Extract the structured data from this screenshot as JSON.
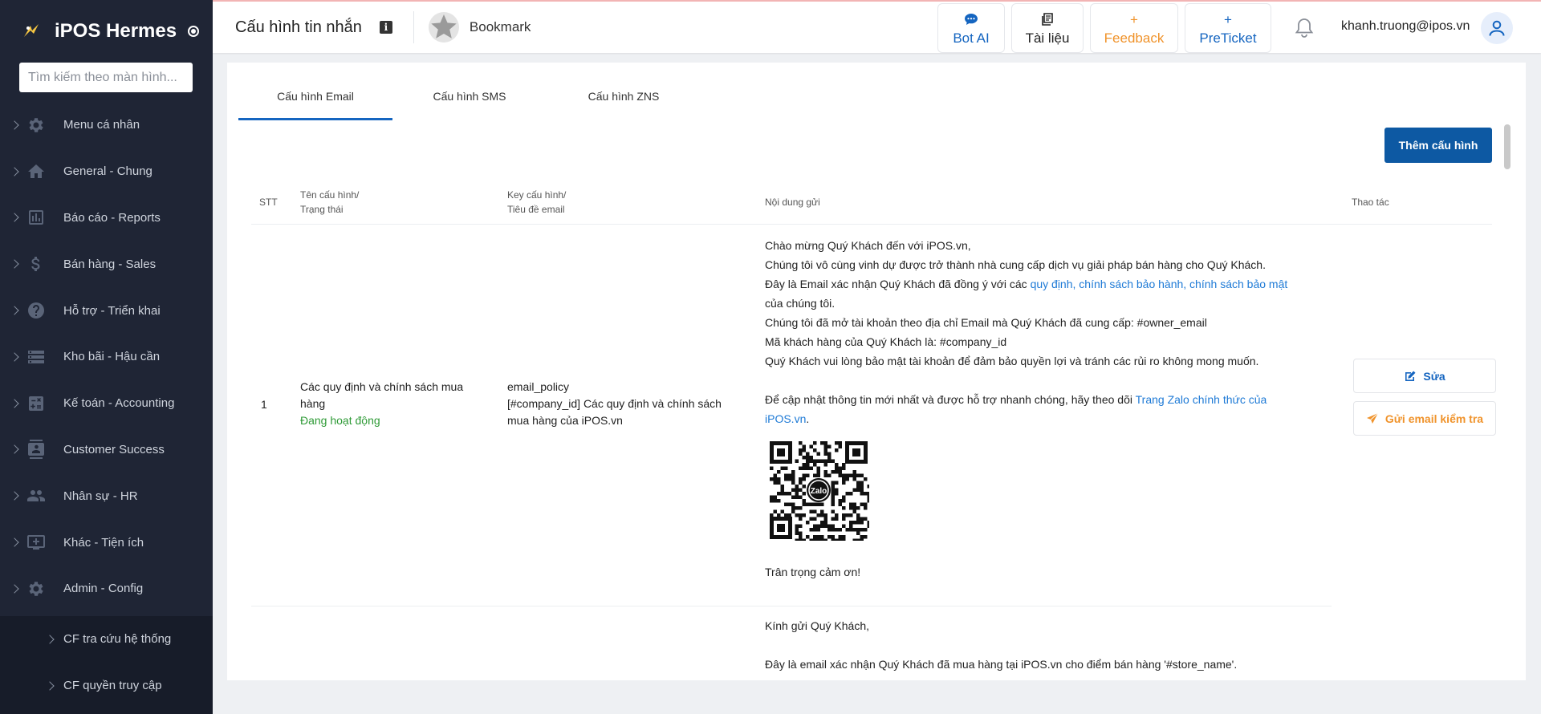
{
  "app": {
    "brand": "iPOS Hermes"
  },
  "sidebar": {
    "search_placeholder": "Tìm kiếm theo màn hình...",
    "items": [
      {
        "label": "Menu cá nhân",
        "icon": "gear-icon"
      },
      {
        "label": "General - Chung",
        "icon": "home-icon"
      },
      {
        "label": "Báo cáo - Reports",
        "icon": "chart-icon"
      },
      {
        "label": "Bán hàng - Sales",
        "icon": "dollar-icon"
      },
      {
        "label": "Hỗ trợ - Triển khai",
        "icon": "help-icon"
      },
      {
        "label": "Kho bãi - Hậu cần",
        "icon": "warehouse-icon"
      },
      {
        "label": "Kế toán - Accounting",
        "icon": "accounting-icon"
      },
      {
        "label": "Customer Success",
        "icon": "customer-icon"
      },
      {
        "label": "Nhân sự - HR",
        "icon": "people-icon"
      },
      {
        "label": "Khác - Tiện ích",
        "icon": "add-screen-icon"
      },
      {
        "label": "Admin - Config",
        "icon": "gear-icon"
      }
    ],
    "subitems": [
      {
        "label": "CF tra cứu hệ thống"
      },
      {
        "label": "CF quyền truy cập"
      }
    ]
  },
  "header": {
    "title": "Cấu hình tin nhắn",
    "info_icon": "i",
    "bookmark_label": "Bookmark",
    "buttons": {
      "bot_ai": "Bot AI",
      "docs": "Tài liệu",
      "feedback": "Feedback",
      "preticket": "PreTicket"
    },
    "plus_glyph": "+",
    "user_email": "khanh.truong@ipos.vn"
  },
  "tabs": [
    {
      "label": "Cấu hình Email",
      "active": true
    },
    {
      "label": "Cấu hình SMS",
      "active": false
    },
    {
      "label": "Cấu hình ZNS",
      "active": false
    }
  ],
  "toolbar": {
    "add_label": "Thêm cấu hình"
  },
  "table": {
    "headers": {
      "stt": "STT",
      "name_line1": "Tên cấu hình/",
      "name_line2": "Trạng thái",
      "key_line1": "Key cấu hình/",
      "key_line2": "Tiêu đề email",
      "content": "Nội dung gửi",
      "actions": "Thao tác"
    },
    "rows": [
      {
        "stt": "1",
        "name": "Các quy định và chính sách mua hàng",
        "status": "Đang hoạt động",
        "key": "email_policy",
        "subject": "[#company_id] Các quy định và chính sách mua hàng của iPOS.vn",
        "content": {
          "l1": "Chào mừng Quý Khách đến với iPOS.vn,",
          "l2": "Chúng tôi vô cùng vinh dự được trở thành nhà cung cấp dịch vụ giải pháp bán hàng cho Quý Khách.",
          "l3_pre": "Đây là Email xác nhận Quý Khách đã đồng ý với các ",
          "l3_link": "quy định, chính sách bảo hành, chính sách bảo mật",
          "l3_post": " của chúng tôi.",
          "l4": "Chúng tôi đã mở tài khoản theo địa chỉ Email mà Quý Khách đã cung cấp: #owner_email",
          "l5": "Mã khách hàng của Quý Khách là: #company_id",
          "l6": "Quý Khách vui lòng bảo mật tài khoản để đảm bảo quyền lợi và tránh các rủi ro không mong muốn.",
          "l7_pre": "Để cập nhật thông tin mới nhất và được hỗ trợ nhanh chóng, hãy theo dõi ",
          "l7_link": "Trang Zalo chính thức của iPOS.vn",
          "l7_post": ".",
          "qr_label": "Zalo",
          "closing": "Trân trọng cảm ơn!"
        },
        "edit_label": "Sửa",
        "test_label": "Gửi email kiểm tra"
      },
      {
        "content": {
          "l1": "Kính gửi Quý Khách,",
          "l2": "Đây là email xác nhận Quý Khách đã mua hàng tại iPOS.vn cho điểm bán hàng '#store_name'."
        }
      }
    ]
  },
  "colors": {
    "sidebar_bg": "#1f2535",
    "primary": "#0d59a3",
    "link": "#1e7ad6",
    "feedback": "#f0932b",
    "status_active": "#2e9a36"
  }
}
